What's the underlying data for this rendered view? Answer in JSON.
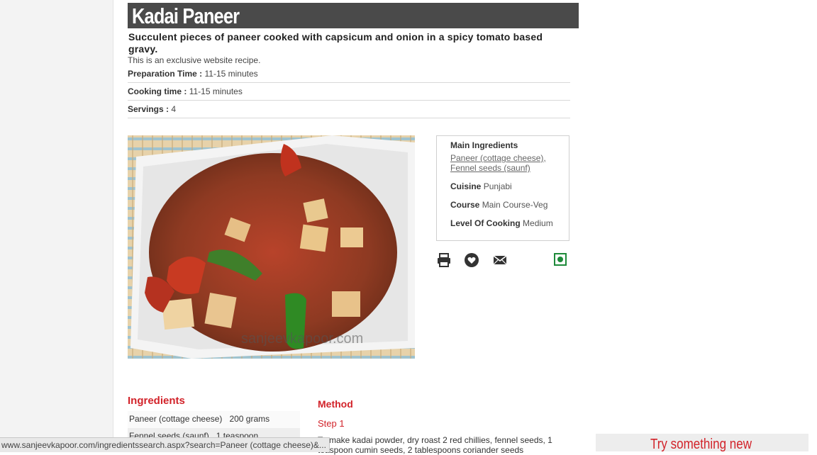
{
  "recipe": {
    "title": "Kadai Paneer",
    "subtitle": "Succulent pieces of paneer cooked with capsicum and onion in a spicy tomato based gravy.",
    "exclusive_note": "This is an exclusive website recipe.",
    "prep_label": "Preparation Time :",
    "prep_value": "11-15 minutes",
    "cook_label": "Cooking time :",
    "cook_value": "11-15 minutes",
    "serv_label": "Servings :",
    "serv_value": "4",
    "image_watermark": "sanjeevkapoor.com"
  },
  "info": {
    "main_ing_label": "Main Ingredients",
    "main_ingredients": [
      "Paneer (cottage cheese),",
      "Fennel seeds (saunf)"
    ],
    "cuisine_label": "Cuisine",
    "cuisine_value": "Punjabi",
    "course_label": "Course",
    "course_value": "Main Course-Veg",
    "level_label": "Level Of Cooking",
    "level_value": "Medium"
  },
  "actions": {
    "icons": [
      "print-icon",
      "heart-icon",
      "mail-icon",
      "veg-icon"
    ],
    "veg_color": "#1e8a3a"
  },
  "ingredients": {
    "heading": "Ingredients",
    "rows": [
      {
        "name": "Paneer (cottage cheese)",
        "qty": "200 grams"
      },
      {
        "name": "Fennel seeds (saunf)",
        "qty": "1 teaspoon"
      }
    ]
  },
  "method": {
    "heading": "Method",
    "step_label": "Step 1",
    "step_text": "To make kadai powder, dry roast 2 red chillies, fennel seeds, 1 teaspoon cumin seeds, 2 tablespoons coriander seeds"
  },
  "promo": {
    "text": "Try something new"
  },
  "status": {
    "url": "www.sanjeevkapoor.com/ingredientssearch.aspx?search=Paneer (cottage cheese)&..."
  },
  "colors": {
    "accent": "#d2232a",
    "title_bar": "#4a4a4a"
  }
}
